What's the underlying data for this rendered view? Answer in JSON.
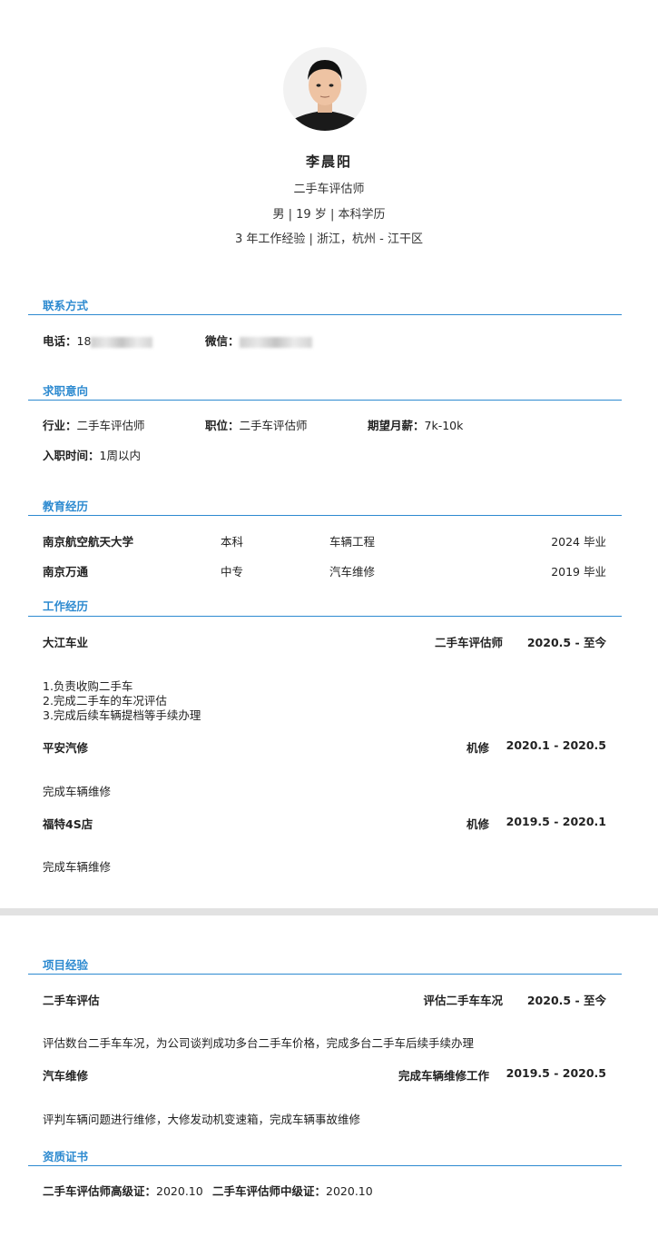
{
  "profile": {
    "name": "李晨阳",
    "title": "二手车评估师",
    "basic": "男 | 19 岁 | 本科学历",
    "location": "3 年工作经验 | 浙江，杭州 - 江干区"
  },
  "contact": {
    "heading": "联系方式",
    "phone_label": "电话：",
    "phone_value": "18",
    "wechat_label": "微信：",
    "wechat_value": ""
  },
  "intent": {
    "heading": "求职意向",
    "industry_label": "行业：",
    "industry_value": "二手车评估师",
    "position_label": "职位：",
    "position_value": "二手车评估师",
    "salary_label": "期望月薪：",
    "salary_value": "7k-10k",
    "start_label": "入职时间：",
    "start_value": "1周以内"
  },
  "education": {
    "heading": "教育经历",
    "rows": [
      {
        "school": "南京航空航天大学",
        "degree": "本科",
        "major": "车辆工程",
        "year": "2024 毕业"
      },
      {
        "school": "南京万通",
        "degree": "中专",
        "major": "汽车维修",
        "year": "2019 毕业"
      }
    ]
  },
  "work": {
    "heading": "工作经历",
    "items": [
      {
        "company": "大江车业",
        "role": "二手车评估师",
        "period": "2020.5 - 至今",
        "lines": [
          "1.负责收购二手车",
          "2.完成二手车的车况评估",
          "3.完成后续车辆提档等手续办理"
        ]
      },
      {
        "company": "平安汽修",
        "role": "机修",
        "period": "2020.1 - 2020.5",
        "lines": [
          "完成车辆维修"
        ]
      },
      {
        "company": "福特4S店",
        "role": "机修",
        "period": "2019.5 - 2020.1",
        "lines": [
          "完成车辆维修"
        ]
      }
    ]
  },
  "projects": {
    "heading": "项目经验",
    "items": [
      {
        "name": "二手车评估",
        "role": "评估二手车车况",
        "period": "2020.5 - 至今",
        "desc": "评估数台二手车车况，为公司谈判成功多台二手车价格，完成多台二手车后续手续办理"
      },
      {
        "name": "汽车维修",
        "role": "完成车辆维修工作",
        "period": "2019.5 - 2020.5",
        "desc": "评判车辆问题进行维修，大修发动机变速箱，完成车辆事故维修"
      }
    ]
  },
  "certificates": {
    "heading": "资质证书",
    "items": [
      {
        "label": "二手车评估师高级证：",
        "date": "2020.10"
      },
      {
        "label": "二手车评估师中级证：",
        "date": "2020.10"
      }
    ]
  },
  "colors": {
    "accent": "#2d8ad0",
    "divider_band": "#e2e2e2"
  }
}
